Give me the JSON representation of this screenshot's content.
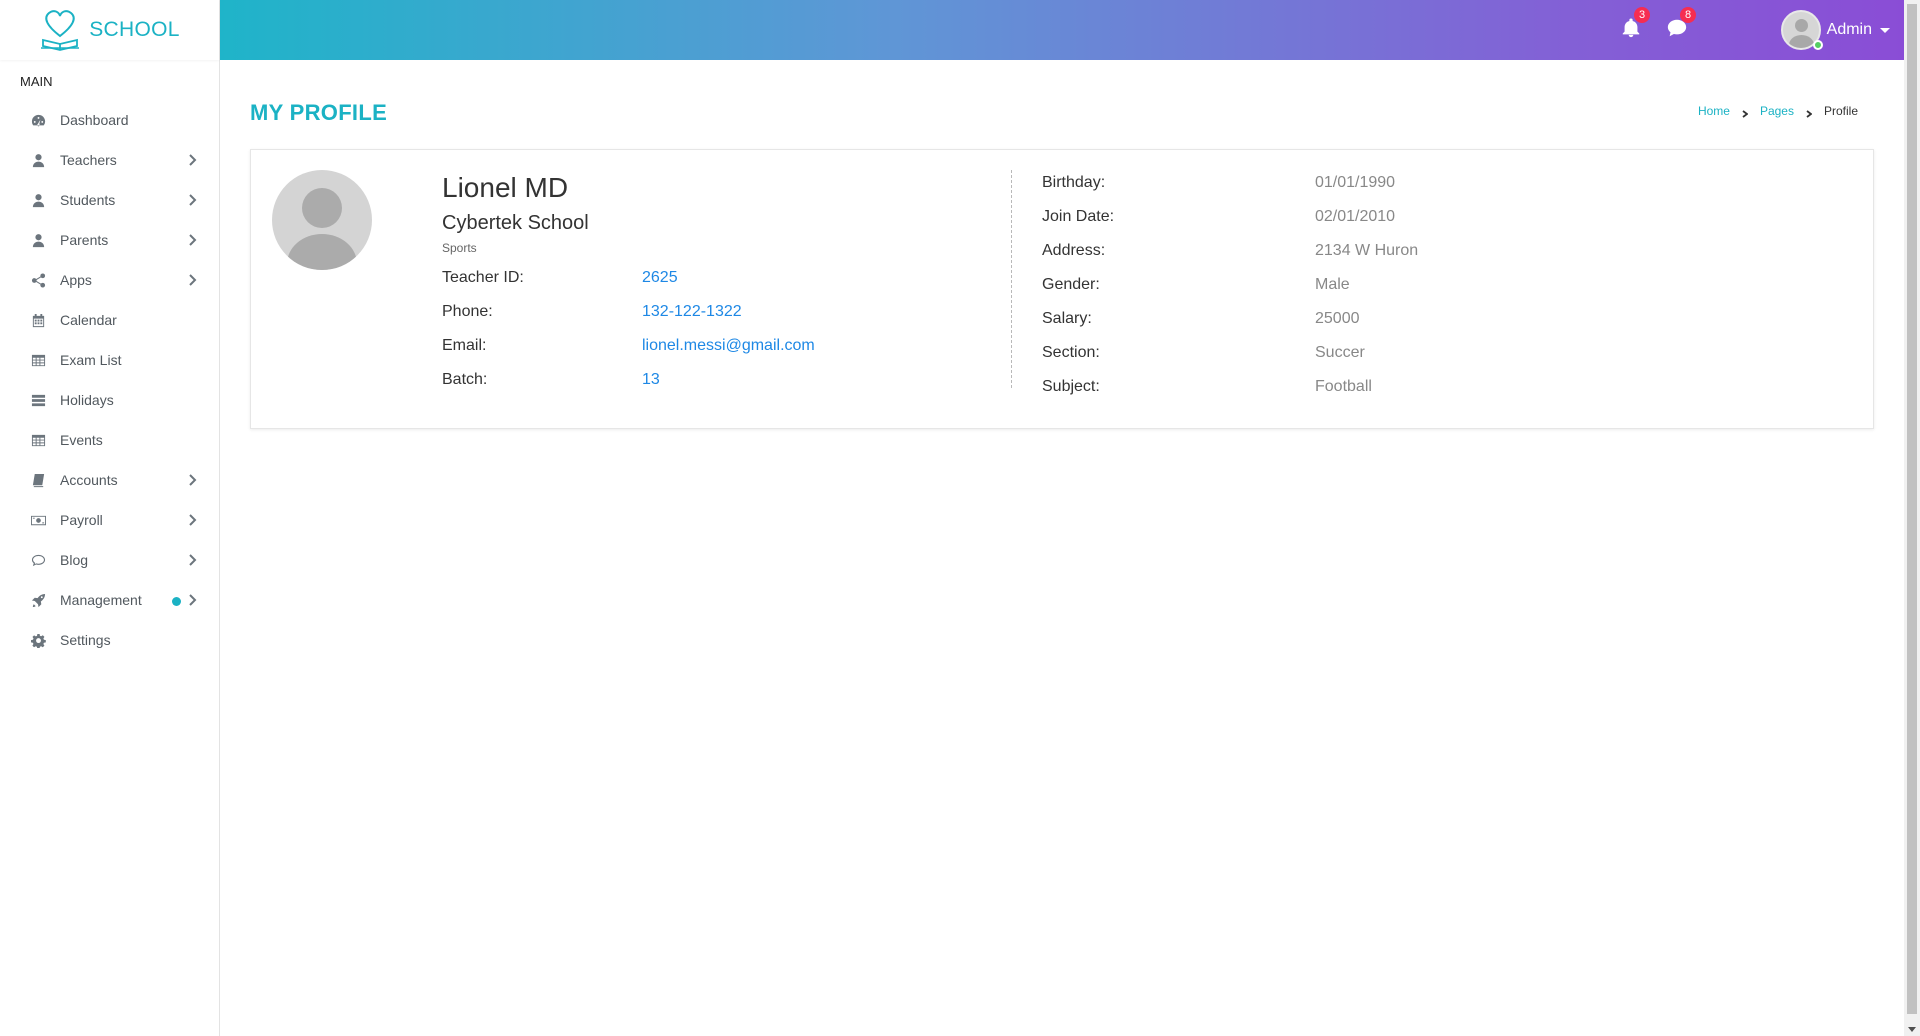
{
  "app": {
    "logo_text": "SCHOOL"
  },
  "sidebar": {
    "section_title": "MAIN",
    "items": [
      {
        "label": "Dashboard",
        "icon": "dashboard-icon",
        "has_submenu": false
      },
      {
        "label": "Teachers",
        "icon": "user-icon",
        "has_submenu": true
      },
      {
        "label": "Students",
        "icon": "user-icon",
        "has_submenu": true
      },
      {
        "label": "Parents",
        "icon": "user-icon",
        "has_submenu": true
      },
      {
        "label": "Apps",
        "icon": "share-icon",
        "has_submenu": true
      },
      {
        "label": "Calendar",
        "icon": "calendar-icon",
        "has_submenu": false
      },
      {
        "label": "Exam List",
        "icon": "table-icon",
        "has_submenu": false
      },
      {
        "label": "Holidays",
        "icon": "list-icon",
        "has_submenu": false
      },
      {
        "label": "Events",
        "icon": "table-icon",
        "has_submenu": false
      },
      {
        "label": "Accounts",
        "icon": "book-icon",
        "has_submenu": true
      },
      {
        "label": "Payroll",
        "icon": "money-icon",
        "has_submenu": true
      },
      {
        "label": "Blog",
        "icon": "comment-icon",
        "has_submenu": true
      },
      {
        "label": "Management",
        "icon": "rocket-icon",
        "has_submenu": true,
        "indicator_dot": true
      },
      {
        "label": "Settings",
        "icon": "gear-icon",
        "has_submenu": false
      }
    ]
  },
  "header": {
    "notifications_count": "3",
    "messages_count": "8",
    "user_name": "Admin",
    "user_status": "online"
  },
  "page": {
    "title": "MY PROFILE",
    "breadcrumb": {
      "home": "Home",
      "pages": "Pages",
      "current": "Profile"
    }
  },
  "profile": {
    "name": "Lionel MD",
    "school": "Cybertek School",
    "department": "Sports",
    "left_fields": [
      {
        "label": "Teacher ID:",
        "value": "2625"
      },
      {
        "label": "Phone:",
        "value": "132-122-1322"
      },
      {
        "label": "Email:",
        "value": "lionel.messi@gmail.com"
      },
      {
        "label": "Batch:",
        "value": "13"
      }
    ],
    "right_fields": [
      {
        "label": "Birthday:",
        "value": "01/01/1990"
      },
      {
        "label": "Join Date:",
        "value": "02/01/2010"
      },
      {
        "label": "Address:",
        "value": "2134 W Huron"
      },
      {
        "label": "Gender:",
        "value": "Male"
      },
      {
        "label": "Salary:",
        "value": "25000"
      },
      {
        "label": "Section:",
        "value": "Succer"
      },
      {
        "label": "Subject:",
        "value": "Football"
      }
    ]
  },
  "colors": {
    "accent": "#1bb2c4",
    "link": "#1e88e5",
    "badge": "#f62d51",
    "header_gradient_start": "#1fb4c9",
    "header_gradient_end": "#8a4dd6"
  }
}
